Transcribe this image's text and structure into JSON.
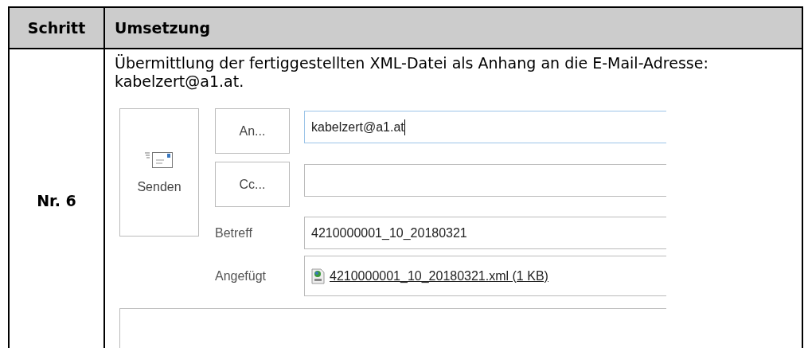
{
  "table": {
    "columns": [
      "Schritt",
      "Umsetzung"
    ],
    "rows": [
      {
        "step": "Nr. 6",
        "text": "Übermittlung der fertiggestellten XML-Datei als Anhang an die E-Mail-Adresse: kabelzert@a1.at.",
        "mail_window": {
          "send_button": "Senden",
          "to_button": "An...",
          "to_value": "kabelzert@a1.at",
          "cc_button": "Cc...",
          "subject_label": "Betreff",
          "subject_value": "4210000001_10_20180321",
          "attached_label": "Angefügt",
          "attachment": "4210000001_10_20180321.xml (1 KB)"
        }
      }
    ]
  }
}
